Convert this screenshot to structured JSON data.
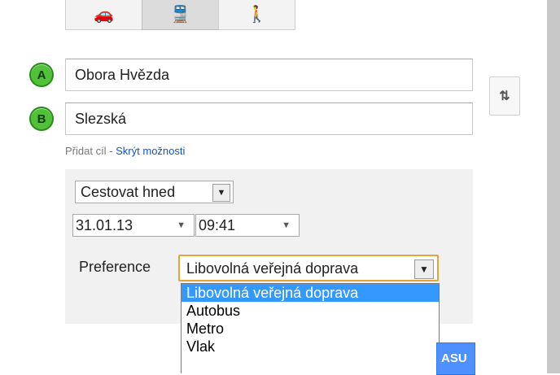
{
  "modes": [
    {
      "name": "car-icon",
      "glyph": "🚗"
    },
    {
      "name": "transit-icon",
      "glyph": "🚆"
    },
    {
      "name": "walk-icon",
      "glyph": "🚶"
    }
  ],
  "markers": {
    "a": "A",
    "b": "B"
  },
  "route": {
    "from": "Obora Hvězda",
    "to": "Slezská"
  },
  "links": {
    "add_destination": "Přidat cíl",
    "separator": " - ",
    "hide_options": "Skrýt možnosti"
  },
  "swap_icon": "⇅",
  "options": {
    "travel_when": "Cestovat hned",
    "date": "31.01.13",
    "time": "09:41",
    "preference_label": "Preference",
    "preference_value": "Libovolná veřejná doprava",
    "preference_options": [
      "Libovolná veřejná doprava",
      "Autobus",
      "Metro",
      "Vlak"
    ]
  },
  "search_button_label": "ASU",
  "colors": {
    "marker_green": "#52c13a",
    "highlight": "#3399ff",
    "focus_border": "#e5a33b",
    "button_blue": "#4d90fe",
    "link": "#1155cc"
  }
}
